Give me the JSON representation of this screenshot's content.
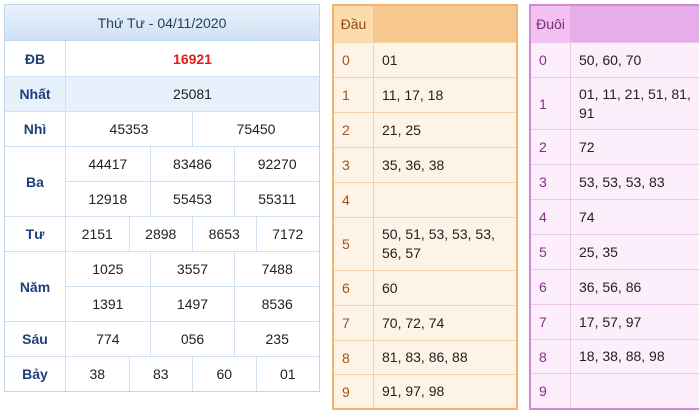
{
  "results": {
    "title": "Thứ Tư - 04/11/2020",
    "rows": [
      {
        "label": "ĐB",
        "lines": [
          [
            "16921"
          ]
        ]
      },
      {
        "label": "Nhất",
        "lines": [
          [
            "25081"
          ]
        ]
      },
      {
        "label": "Nhì",
        "lines": [
          [
            "45353",
            "75450"
          ]
        ]
      },
      {
        "label": "Ba",
        "lines": [
          [
            "44417",
            "83486",
            "92270"
          ],
          [
            "12918",
            "55453",
            "55311"
          ]
        ]
      },
      {
        "label": "Tư",
        "lines": [
          [
            "2151",
            "2898",
            "8653",
            "7172"
          ]
        ]
      },
      {
        "label": "Năm",
        "lines": [
          [
            "1025",
            "3557",
            "7488"
          ],
          [
            "1391",
            "1497",
            "8536"
          ]
        ]
      },
      {
        "label": "Sáu",
        "lines": [
          [
            "774",
            "056",
            "235"
          ]
        ]
      },
      {
        "label": "Bảy",
        "lines": [
          [
            "38",
            "83",
            "60",
            "01"
          ]
        ]
      }
    ]
  },
  "dau": {
    "header": "Đầu",
    "rows": [
      {
        "key": "0",
        "value": "01"
      },
      {
        "key": "1",
        "value": "11, 17, 18"
      },
      {
        "key": "2",
        "value": "21, 25"
      },
      {
        "key": "3",
        "value": "35, 36, 38"
      },
      {
        "key": "4",
        "value": ""
      },
      {
        "key": "5",
        "value": "50, 51, 53, 53, 53, 56, 57"
      },
      {
        "key": "6",
        "value": "60"
      },
      {
        "key": "7",
        "value": "70, 72, 74"
      },
      {
        "key": "8",
        "value": "81, 83, 86, 88"
      },
      {
        "key": "9",
        "value": "91, 97, 98"
      }
    ]
  },
  "duoi": {
    "header": "Đuôi",
    "rows": [
      {
        "key": "0",
        "value": "50, 60, 70"
      },
      {
        "key": "1",
        "value": "01, 11, 21, 51, 81, 91"
      },
      {
        "key": "2",
        "value": "72"
      },
      {
        "key": "3",
        "value": "53, 53, 53, 83"
      },
      {
        "key": "4",
        "value": "74"
      },
      {
        "key": "5",
        "value": "25, 35"
      },
      {
        "key": "6",
        "value": "36, 56, 86"
      },
      {
        "key": "7",
        "value": "17, 57, 97"
      },
      {
        "key": "8",
        "value": "18, 38, 88, 98"
      },
      {
        "key": "9",
        "value": ""
      }
    ]
  },
  "colors": {
    "special_prize": "#e31b1b",
    "results_border": "#bfd6ee",
    "dau_accent": "#f0b372",
    "duoi_accent": "#d08ad6"
  }
}
